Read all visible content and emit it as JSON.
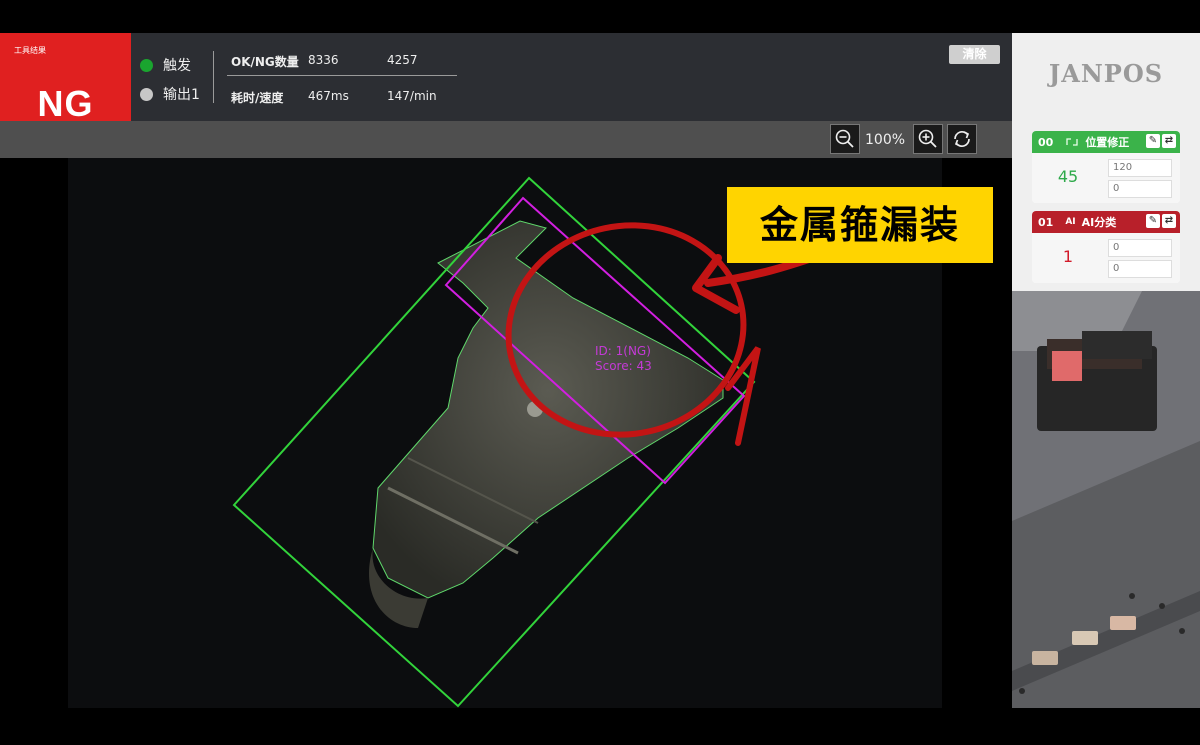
{
  "result": {
    "caption": "工具结果",
    "value": "NG"
  },
  "status": [
    {
      "label": "触发",
      "color": "#1aa52f"
    },
    {
      "label": "输出1",
      "color": "#c7c7c7"
    }
  ],
  "stats": {
    "count_label": "OK/NG数量",
    "ok_count": "8336",
    "ng_count": "4257",
    "time_label": "耗时/速度",
    "time_value": "467ms",
    "speed_value": "147/min"
  },
  "clear_label": "清除",
  "toolbar": {
    "zoom": "100%"
  },
  "detection": {
    "id_text": "ID: 1(NG)",
    "score_text": "Score: 43"
  },
  "annotation": "金属箍漏装",
  "brand": "JANPOS",
  "tools": [
    {
      "index": "00",
      "name": "位置修正",
      "score": "45",
      "param1": "120",
      "param2": "0",
      "color": "#3bb34a"
    },
    {
      "index": "01",
      "name": "AI分类",
      "score": "1",
      "param1": "0",
      "param2": "0",
      "color": "#b8202a"
    }
  ]
}
